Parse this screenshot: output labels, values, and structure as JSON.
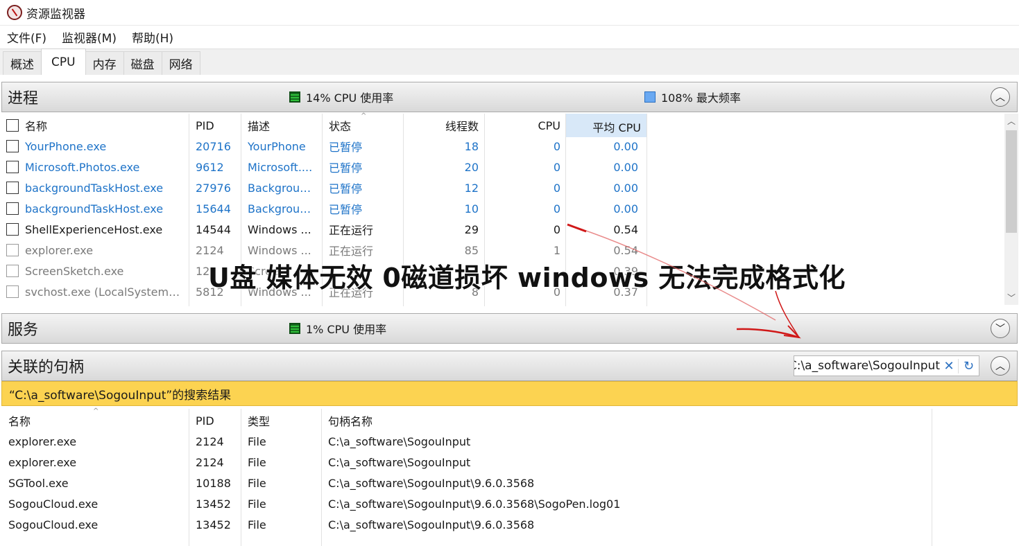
{
  "window": {
    "title": "资源监视器",
    "icon": "resource-monitor-icon"
  },
  "menu": [
    "文件(F)",
    "监视器(M)",
    "帮助(H)"
  ],
  "tabs": [
    "概述",
    "CPU",
    "内存",
    "磁盘",
    "网络"
  ],
  "active_tab": "CPU",
  "processes": {
    "title": "进程",
    "cpu_legend": "14% CPU 使用率",
    "freq_legend": "108% 最大频率",
    "columns": [
      "名称",
      "PID",
      "描述",
      "状态",
      "线程数",
      "CPU",
      "平均 CPU"
    ],
    "rows": [
      {
        "name": "YourPhone.exe",
        "pid": "20716",
        "desc": "YourPhone",
        "status": "已暂停",
        "threads": "18",
        "cpu": "0",
        "avg": "0.00",
        "style": "suspended"
      },
      {
        "name": "Microsoft.Photos.exe",
        "pid": "9612",
        "desc": "Microsoft....",
        "status": "已暂停",
        "threads": "20",
        "cpu": "0",
        "avg": "0.00",
        "style": "suspended"
      },
      {
        "name": "backgroundTaskHost.exe",
        "pid": "27976",
        "desc": "Backgroun...",
        "status": "已暂停",
        "threads": "12",
        "cpu": "0",
        "avg": "0.00",
        "style": "suspended"
      },
      {
        "name": "backgroundTaskHost.exe",
        "pid": "15644",
        "desc": "Backgroun...",
        "status": "已暂停",
        "threads": "10",
        "cpu": "0",
        "avg": "0.00",
        "style": "suspended"
      },
      {
        "name": "ShellExperienceHost.exe",
        "pid": "14544",
        "desc": "Windows ...",
        "status": "正在运行",
        "threads": "29",
        "cpu": "0",
        "avg": "0.54",
        "style": "normal"
      },
      {
        "name": "explorer.exe",
        "pid": "2124",
        "desc": "Windows ...",
        "status": "正在运行",
        "threads": "85",
        "cpu": "1",
        "avg": "0.54",
        "style": "faded"
      },
      {
        "name": "ScreenSketch.exe",
        "pid": "12",
        "desc": "Scree",
        "status": "",
        "threads": "",
        "cpu": "",
        "avg": "0.39",
        "style": "faded"
      },
      {
        "name": "svchost.exe (LocalSystemNet...",
        "pid": "5812",
        "desc": "Windows ...",
        "status": "正在运行",
        "threads": "8",
        "cpu": "0",
        "avg": "0.37",
        "style": "faded"
      }
    ]
  },
  "services": {
    "title": "服务",
    "cpu_legend": "1% CPU 使用率"
  },
  "handles": {
    "title": "关联的句柄",
    "search_value": "C:\\a_software\\SogouInput",
    "result_label": "“C:\\a_software\\SogouInput”的搜索结果",
    "columns": [
      "名称",
      "PID",
      "类型",
      "句柄名称"
    ],
    "rows": [
      {
        "name": "explorer.exe",
        "pid": "2124",
        "type": "File",
        "handle": "C:\\a_software\\SogouInput"
      },
      {
        "name": "explorer.exe",
        "pid": "2124",
        "type": "File",
        "handle": "C:\\a_software\\SogouInput"
      },
      {
        "name": "SGTool.exe",
        "pid": "10188",
        "type": "File",
        "handle": "C:\\a_software\\SogouInput\\9.6.0.3568"
      },
      {
        "name": "SogouCloud.exe",
        "pid": "13452",
        "type": "File",
        "handle": "C:\\a_software\\SogouInput\\9.6.0.3568\\SogoPen.log01"
      },
      {
        "name": "SogouCloud.exe",
        "pid": "13452",
        "type": "File",
        "handle": "C:\\a_software\\SogouInput\\9.6.0.3568"
      }
    ]
  },
  "overlay_caption": "U盘  媒体无效 0磁道损坏 windows 无法完成格式化",
  "colors": {
    "accent_blue": "#1e73c8",
    "result_bar": "#fcd351",
    "annotation_red": "#d01818"
  }
}
